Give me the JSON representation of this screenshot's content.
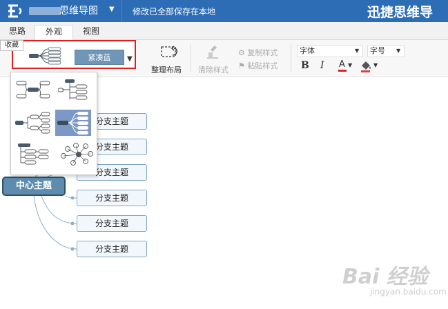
{
  "header": {
    "app_name": "思维导图",
    "dropdown_glyph": "▼",
    "save_status": "修改已全部保存在本地",
    "brand": "迅捷思维导"
  },
  "tabs": [
    {
      "label": "思路"
    },
    {
      "label": "外观"
    },
    {
      "label": "视图"
    }
  ],
  "toolbar": {
    "collect_tag": "收藏",
    "theme_label": "紧凑蓝",
    "layout_label": "整理布局",
    "clear_style_label": "清除样式",
    "copy_style_label": "复制样式",
    "paste_style_label": "粘贴样式",
    "font_placeholder": "字体",
    "size_placeholder": "字号",
    "bold_label": "B",
    "italic_label": "I",
    "font_color_label": "A"
  },
  "colors": {
    "title_bar": "#2d6db5",
    "theme_button": "#6f96b6",
    "center_topic": "#5d8cae",
    "highlight_border": "#e02020",
    "selected_structure": "#7c98c4",
    "font_color_bar": "#d9262c"
  },
  "mindmap": {
    "center": "中心主题",
    "branches": [
      "分支主题",
      "分支主题",
      "分支主题",
      "分支主题",
      "分支主题",
      "分支主题"
    ]
  },
  "structure_popup": {
    "options": [
      "structure-1-icon",
      "structure-2-icon",
      "structure-3-icon",
      "structure-4-icon",
      "structure-5-icon",
      "structure-6-icon"
    ],
    "selected_index": 3
  },
  "watermark": {
    "main": "Bai 经验",
    "sub": "jingyan.baidu.com"
  }
}
